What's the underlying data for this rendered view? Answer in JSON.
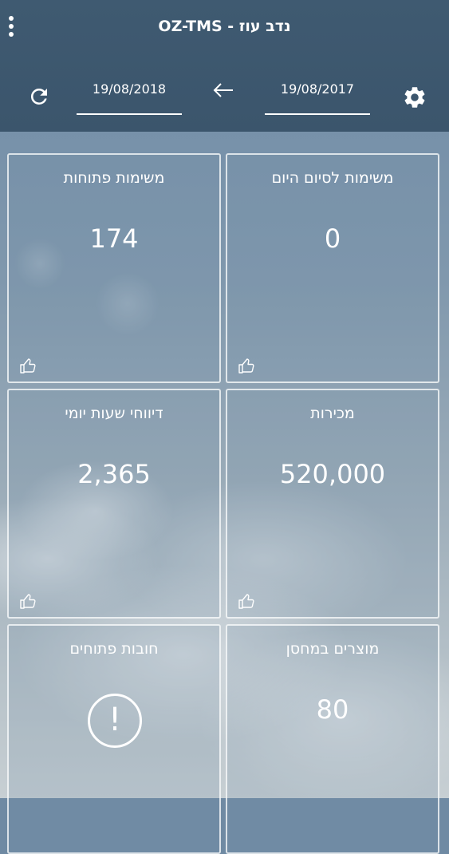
{
  "header": {
    "title": "נדב עוז - OZ-TMS",
    "from_date": "19/08/2017",
    "to_date": "19/08/2018",
    "icons": [
      "menu-dots-icon",
      "refresh-icon",
      "arrow-left-icon",
      "gear-icon"
    ]
  },
  "tiles": [
    {
      "label": "משימות לסיום היום",
      "value": "0",
      "icon": "thumbs-up-icon"
    },
    {
      "label": "משימות פתוחות",
      "value": "174",
      "icon": "thumbs-up-icon"
    },
    {
      "label": "מכירות",
      "value": "520,000",
      "icon": "thumbs-up-icon"
    },
    {
      "label": "דיווחי שעות יומי",
      "value": "2,365",
      "icon": "thumbs-up-icon"
    },
    {
      "label": "מוצרים במחסן",
      "value": "80"
    },
    {
      "label": "חובות פתוחים",
      "icon": "alert-icon",
      "icon_glyph": "!"
    }
  ],
  "colors": {
    "header": "#3f5a71",
    "text": "#ffffff"
  }
}
